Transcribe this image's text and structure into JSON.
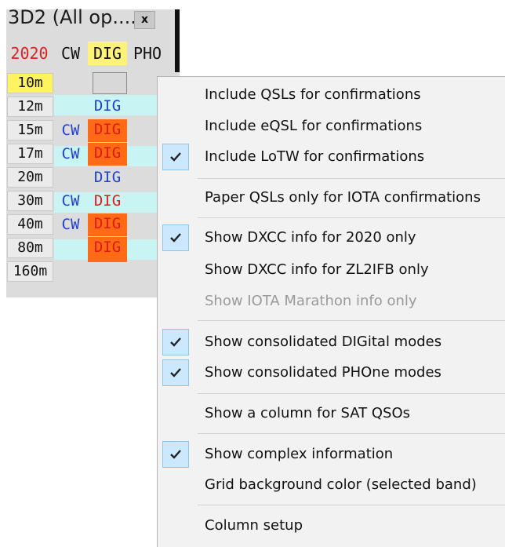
{
  "window": {
    "title": "3D2 (All op....",
    "close_glyph": "x",
    "headers": {
      "year": "2020",
      "cw": "CW",
      "dig": "DIG",
      "pho": "PHO"
    },
    "rows": [
      {
        "band": "10m",
        "cw": "",
        "dig": "",
        "selected": true
      },
      {
        "band": "12m",
        "cw": "",
        "dig": "DIG"
      },
      {
        "band": "15m",
        "cw": "CW",
        "dig": "DIG"
      },
      {
        "band": "17m",
        "cw": "CW",
        "dig": "DIG"
      },
      {
        "band": "20m",
        "cw": "",
        "dig": "DIG"
      },
      {
        "band": "30m",
        "cw": "CW",
        "dig": "DIG"
      },
      {
        "band": "40m",
        "cw": "CW",
        "dig": "DIG"
      },
      {
        "band": "80m",
        "cw": "",
        "dig": "DIG"
      },
      {
        "band": "160m",
        "cw": "",
        "dig": ""
      }
    ]
  },
  "colors": {
    "year_red": "#e02020",
    "mode_blue": "#1f3fd6",
    "unconfirmed_red": "#e01818",
    "needed_orange": "#ff6a14",
    "selected_yellow": "#fff45f",
    "row_cyan": "#c9f4f4",
    "check_bg": "#cce8ff"
  },
  "menu": {
    "items": [
      {
        "label": "Include QSLs for confirmations",
        "checked": false,
        "enabled": true
      },
      {
        "label": "Include eQSL for confirmations",
        "checked": false,
        "enabled": true
      },
      {
        "label": "Include LoTW for confirmations",
        "checked": true,
        "enabled": true
      },
      {
        "label": "Paper QSLs only for IOTA confirmations",
        "checked": false,
        "enabled": true
      },
      {
        "label": "Show DXCC info for 2020 only",
        "checked": true,
        "enabled": true
      },
      {
        "label": "Show DXCC info for ZL2IFB only",
        "checked": false,
        "enabled": true
      },
      {
        "label": "Show IOTA Marathon info only",
        "checked": false,
        "enabled": false
      },
      {
        "label": "Show consolidated DIGital modes",
        "checked": true,
        "enabled": true
      },
      {
        "label": "Show consolidated PHOne modes",
        "checked": true,
        "enabled": true
      },
      {
        "label": "Show a column for SAT QSOs",
        "checked": false,
        "enabled": true
      },
      {
        "label": "Show complex information",
        "checked": true,
        "enabled": true
      },
      {
        "label": "Grid background color (selected band)",
        "checked": false,
        "enabled": true
      },
      {
        "label": "Column setup",
        "checked": false,
        "enabled": true
      }
    ],
    "check_icon": "checkmark-icon"
  }
}
